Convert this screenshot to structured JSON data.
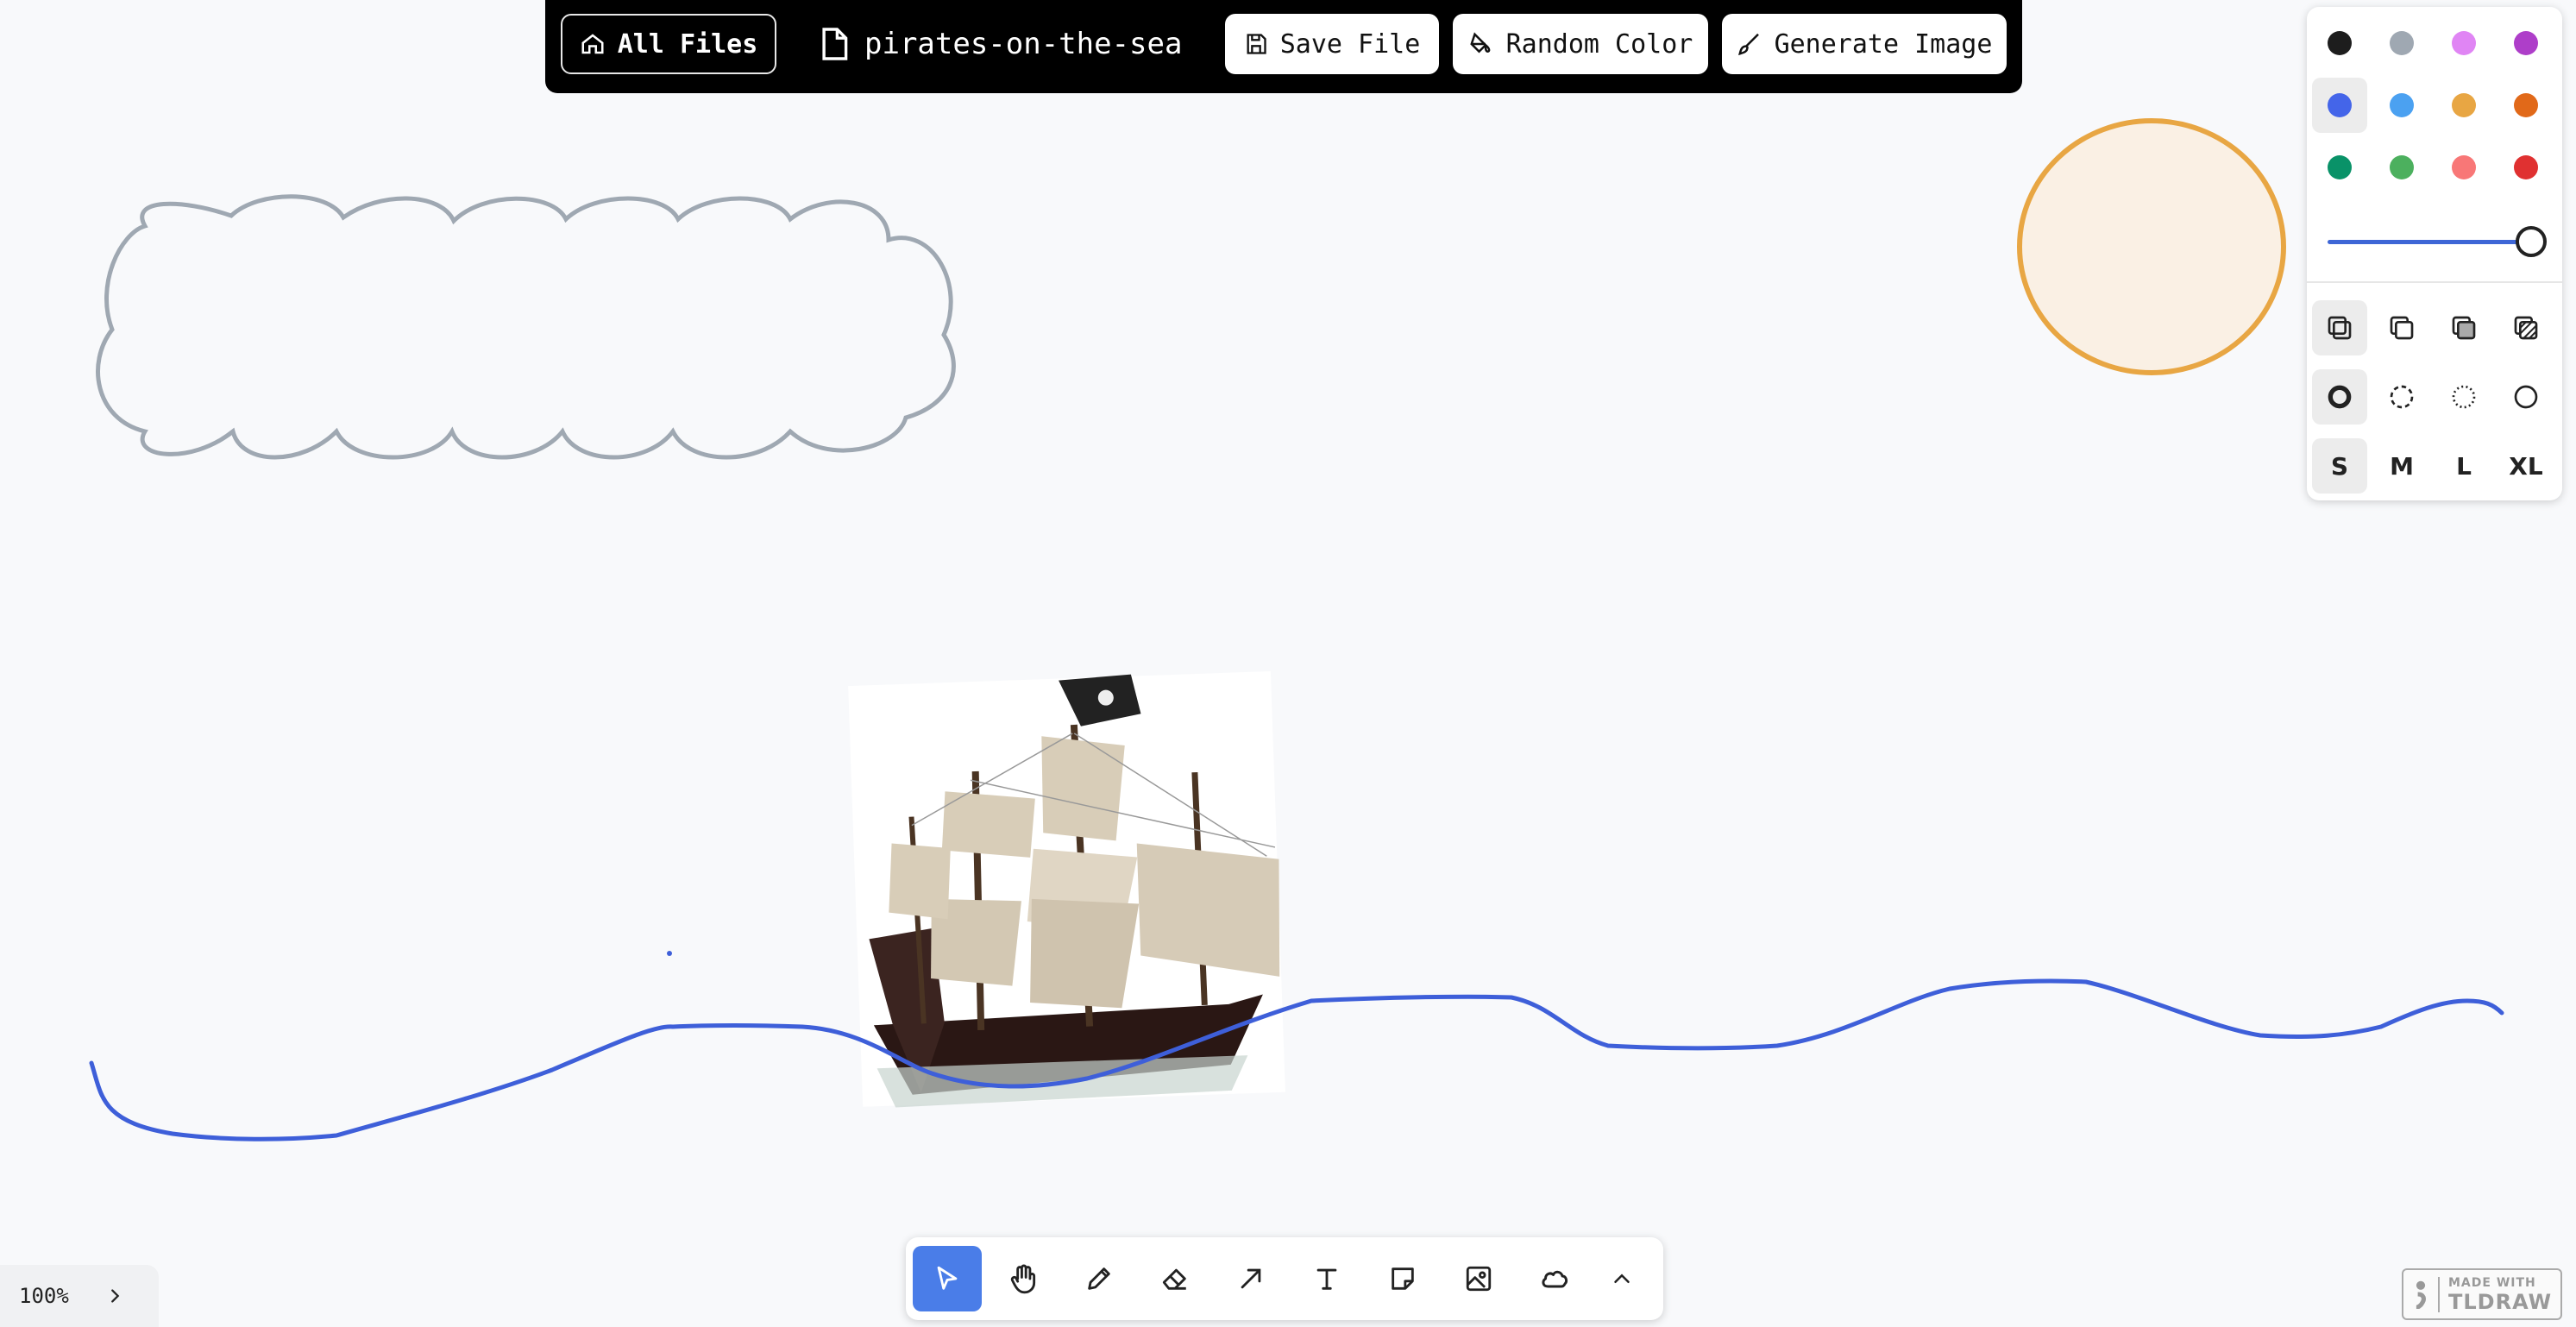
{
  "topbar": {
    "all_files_label": "All Files",
    "file_name": "pirates-on-the-sea",
    "save_label": "Save File",
    "random_color_label": "Random Color",
    "generate_label": "Generate Image"
  },
  "style_panel": {
    "colors": [
      "#1d1d1d",
      "#9fa8b2",
      "#e085f4",
      "#ae3ec9",
      "#4465e9",
      "#4ba1f1",
      "#e8a643",
      "#e16919",
      "#099268",
      "#4cb05e",
      "#f87777",
      "#e03131"
    ],
    "selected_color": "#4465e9",
    "opacity_percent": 100,
    "fill_options": [
      "none",
      "semi",
      "solid",
      "pattern"
    ],
    "dash_options": [
      "draw",
      "dashed",
      "dotted",
      "solid"
    ],
    "size_options": [
      "S",
      "M",
      "L",
      "XL"
    ],
    "selected_size": "S"
  },
  "toolbar": {
    "tools": [
      "select-tool",
      "hand-tool",
      "draw-tool",
      "eraser-tool",
      "arrow-tool",
      "text-tool",
      "note-tool",
      "asset-tool",
      "cloud-tool",
      "more-tools"
    ],
    "active_tool": "select-tool"
  },
  "zoom": {
    "label": "100%"
  },
  "watermark": {
    "line1": "MADE WITH",
    "line2": "TLDRAW"
  },
  "colors": {
    "accent": "#4a7de8",
    "wave": "#3e5fd9",
    "sun_stroke": "#e8a643",
    "sun_fill": "#faf0e4",
    "cloud_stroke": "#9fa8b2"
  }
}
